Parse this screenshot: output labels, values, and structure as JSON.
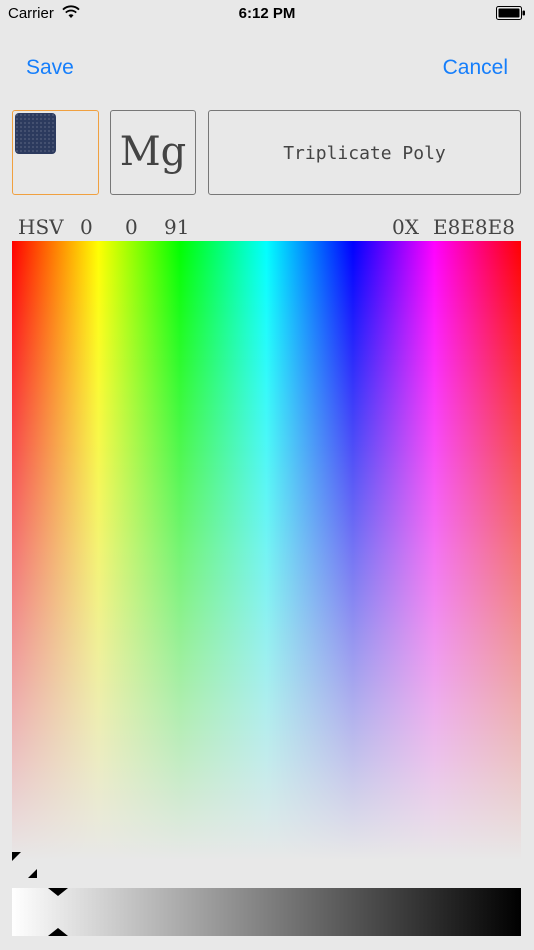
{
  "status_bar": {
    "carrier": "Carrier",
    "time": "6:12 PM"
  },
  "nav": {
    "save_label": "Save",
    "cancel_label": "Cancel"
  },
  "preview": {
    "swatch_color": "#2c3a5e",
    "font_sample": "Mg",
    "font_name": "Triplicate Poly"
  },
  "readout": {
    "hsv_label": "HSV",
    "h": "0",
    "s": "0",
    "v": "91",
    "hex_prefix": "0X",
    "hex_value": "E8E8E8"
  },
  "colors": {
    "accent": "#157efb",
    "selected_border": "#f0a040",
    "background": "#e8e8e8"
  },
  "value_slider": {
    "level": 0.09
  }
}
